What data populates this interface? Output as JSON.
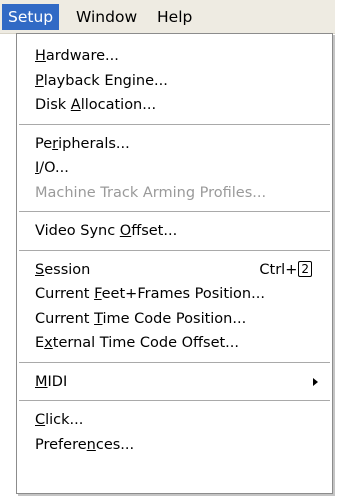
{
  "menubar": {
    "items": [
      {
        "label": "Setup",
        "active": true
      },
      {
        "label": "Window",
        "active": false
      },
      {
        "label": "Help",
        "active": false
      }
    ]
  },
  "menu": {
    "groups": [
      [
        {
          "label": "Hardware...",
          "mnemonic": "H",
          "disabled": false
        },
        {
          "label": "Playback Engine...",
          "mnemonic": "P",
          "disabled": false
        },
        {
          "label": "Disk Allocation...",
          "mnemonic": "A",
          "disabled": false
        }
      ],
      [
        {
          "label": "Peripherals...",
          "mnemonic": "r",
          "disabled": false
        },
        {
          "label": "I/O...",
          "mnemonic": "I",
          "disabled": false
        },
        {
          "label": "Machine Track Arming Profiles...",
          "mnemonic": "",
          "disabled": true
        }
      ],
      [
        {
          "label": "Video Sync Offset...",
          "mnemonic": "O",
          "disabled": false
        }
      ],
      [
        {
          "label": "Session",
          "mnemonic": "S",
          "disabled": false,
          "shortcut_prefix": "Ctrl+",
          "shortcut_key": "2"
        },
        {
          "label": "Current Feet+Frames Position...",
          "mnemonic": "F",
          "disabled": false
        },
        {
          "label": "Current Time Code Position...",
          "mnemonic": "T",
          "disabled": false
        },
        {
          "label": "External Time Code Offset...",
          "mnemonic": "x",
          "disabled": false
        }
      ],
      [
        {
          "label": "MIDI",
          "mnemonic": "M",
          "disabled": false,
          "submenu": true,
          "icon": "submenu-arrow-icon"
        }
      ],
      [
        {
          "label": "Click...",
          "mnemonic": "C",
          "disabled": false
        },
        {
          "label": "Preferences...",
          "mnemonic": "n",
          "disabled": false
        }
      ]
    ]
  },
  "colors": {
    "menubar_bg": "#eeebe2",
    "highlight": "#316ac5",
    "disabled_text": "#9a9a9a"
  }
}
